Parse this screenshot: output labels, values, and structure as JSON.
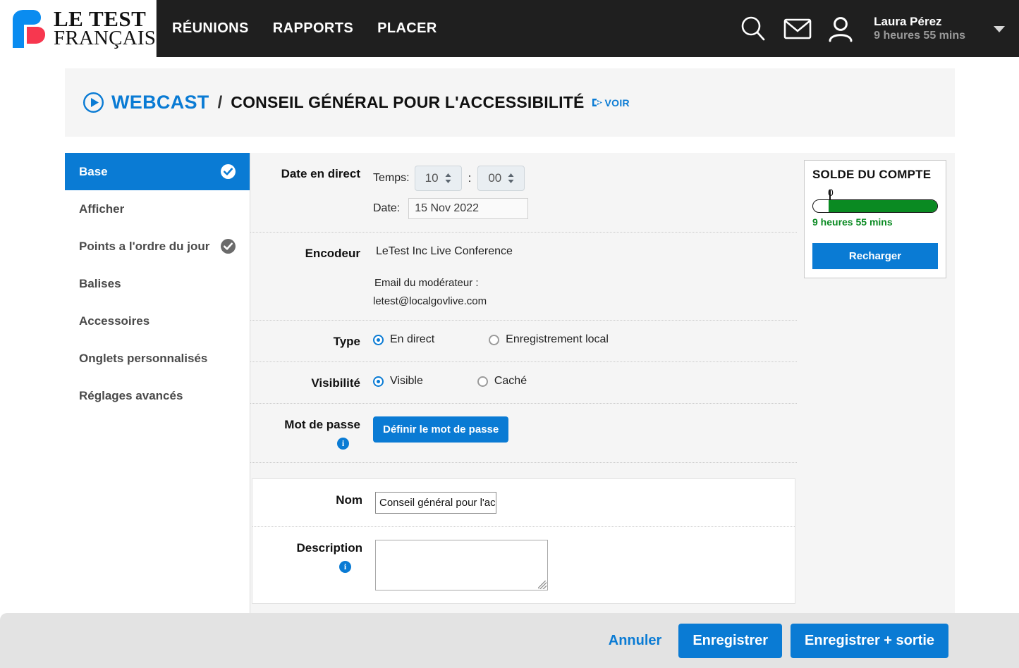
{
  "brand": {
    "line1": "LE TEST",
    "line2": "FRANÇAIS",
    "logo_blue": "#0a8cf0",
    "logo_red": "#f7374f"
  },
  "nav": {
    "links": [
      {
        "label": "RÉUNIONS"
      },
      {
        "label": "RAPPORTS"
      },
      {
        "label": "PLACER"
      }
    ],
    "icons": [
      "search-icon",
      "mail-icon",
      "user-icon",
      "chevron-down-icon"
    ],
    "user_name": "Laura Pérez",
    "user_time": "9 heures 55 mins",
    "bar_color": "#1f1f1f"
  },
  "breadcrumb": {
    "section": "WEBCAST",
    "separator": "/",
    "title": "CONSEIL GÉNÉRAL POUR L'ACCESSIBILITÉ",
    "view_link": "VOIR",
    "accent": "#0a7bd4"
  },
  "sidebar": {
    "items": [
      {
        "label": "Base",
        "active": true,
        "check": "blue"
      },
      {
        "label": "Afficher",
        "active": false,
        "check": "none"
      },
      {
        "label": "Points a l'ordre du jour",
        "active": false,
        "check": "gray"
      },
      {
        "label": "Balises",
        "active": false,
        "check": "none"
      },
      {
        "label": "Accessoires",
        "active": false,
        "check": "none"
      },
      {
        "label": "Onglets personnalisés",
        "active": false,
        "check": "none"
      },
      {
        "label": "Réglages avancés",
        "active": false,
        "check": "none"
      }
    ]
  },
  "form": {
    "live_date": {
      "label": "Date en direct",
      "time_label": "Temps:",
      "hour_value": "10",
      "minute_value": "00",
      "colon": ":",
      "date_label": "Date:",
      "date_value": "15 Nov 2022"
    },
    "encoder": {
      "label": "Encodeur",
      "value": "LeTest Inc Live Conference",
      "moderator_label": "Email du modérateur :",
      "moderator_email": "letest@localgovlive.com"
    },
    "type": {
      "label": "Type",
      "option_1": "En direct",
      "option_2": "Enregistrement local",
      "selected": "En direct"
    },
    "visibility": {
      "label": "Visibilité",
      "option_1": "Visible",
      "option_2": "Caché",
      "selected": "Visible"
    },
    "password": {
      "label": "Mot de passe",
      "button": "Définir le mot de passe",
      "info": "i"
    },
    "name": {
      "label": "Nom",
      "value": "Conseil général pour l'acc"
    },
    "description": {
      "label": "Description",
      "value": "",
      "info": "i"
    }
  },
  "balance": {
    "title": "SOLDE DU COMPTE",
    "zero_label": "0",
    "amount": "9 heures 55 mins",
    "recharge_button": "Recharger",
    "fill_color": "#0a8a22"
  },
  "footer": {
    "cancel": "Annuler",
    "save": "Enregistrer",
    "save_exit": "Enregistrer + sortie"
  }
}
